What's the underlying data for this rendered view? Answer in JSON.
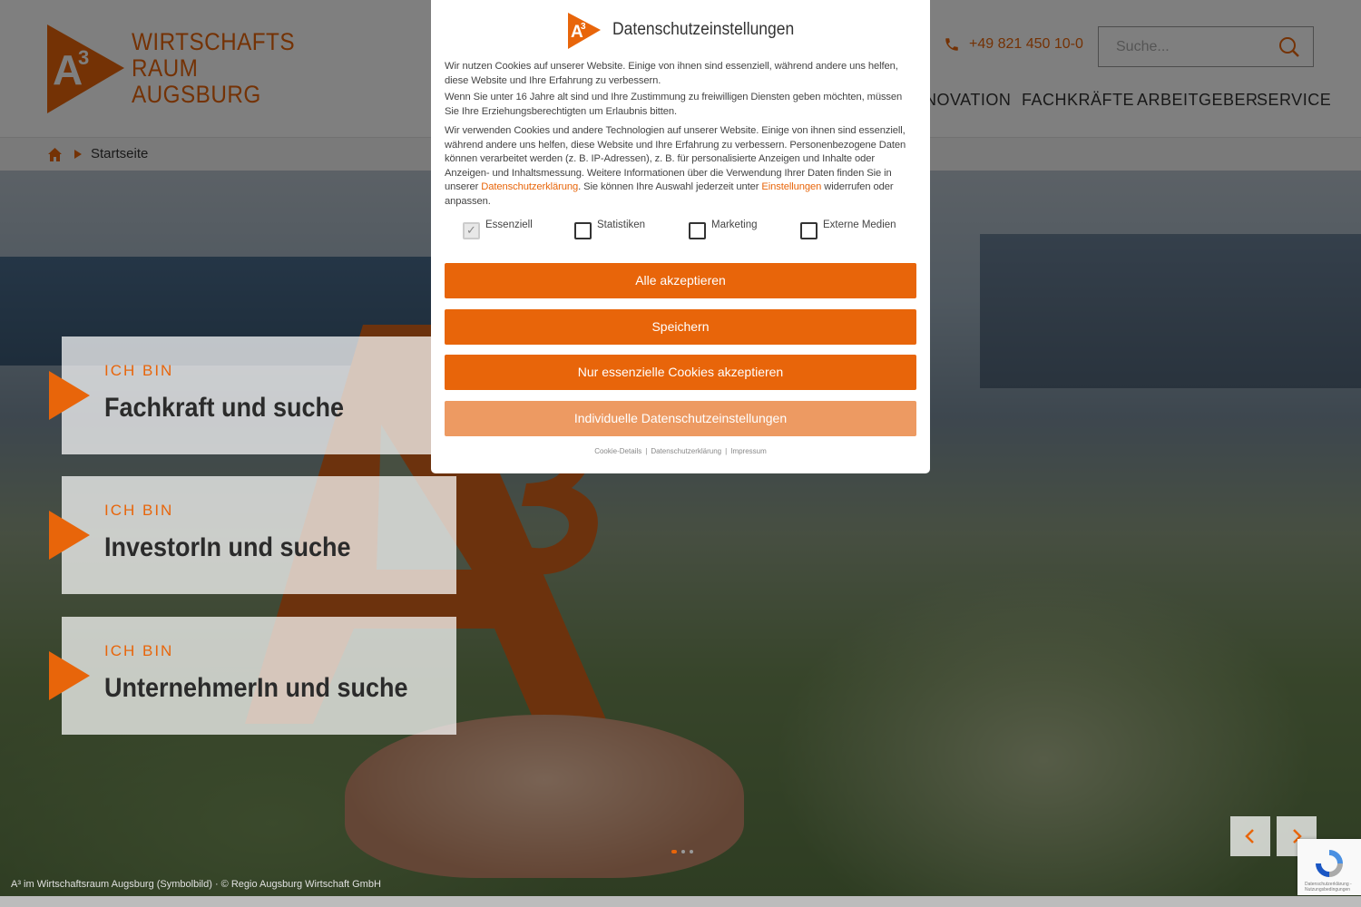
{
  "header": {
    "logo_lines": [
      "WIRTSCHAFTS",
      "RAUM",
      "AUGSBURG"
    ],
    "phone": "+49 821 450 10-0",
    "search_placeholder": "Suche...",
    "nav": [
      "INNOVATION",
      "FACHKRÄFTE",
      "ARBEITGEBER",
      "SERVICE"
    ]
  },
  "breadcrumb": {
    "current": "Startseite"
  },
  "hero": {
    "cards": [
      {
        "kicker": "ICH BIN",
        "title": "Fachkraft und suche"
      },
      {
        "kicker": "ICH BIN",
        "title": "InvestorIn und suche"
      },
      {
        "kicker": "ICH BIN",
        "title": "UnternehmerIn und suche"
      }
    ],
    "caption": "A³ im Wirtschaftsraum Augsburg (Symbolbild) · © Regio Augsburg Wirtschaft GmbH"
  },
  "recaptcha": {
    "text": "Datenschutzerklärung - Nutzungsbedingungen"
  },
  "consent": {
    "title": "Datenschutzeinstellungen",
    "p1": "Wir nutzen Cookies auf unserer Website. Einige von ihnen sind essenziell, während andere uns helfen, diese Website und Ihre Erfahrung zu verbessern.",
    "p2": "Wenn Sie unter 16 Jahre alt sind und Ihre Zustimmung zu freiwilligen Diensten geben möchten, müssen Sie Ihre Erziehungsberechtigten um Erlaubnis bitten.",
    "p3_before": "Wir verwenden Cookies und andere Technologien auf unserer Website. Einige von ihnen sind essenziell, während andere uns helfen, diese Website und Ihre Erfahrung zu verbessern. Personenbezogene Daten können verarbeitet werden (z. B. IP-Adressen), z. B. für personalisierte Anzeigen und Inhalte oder Anzeigen- und Inhaltsmessung. Weitere Informationen über die Verwendung Ihrer Daten finden Sie in unserer ",
    "p3_link1": "Datenschutzerklärung",
    "p3_middle": ". Sie können Ihre Auswahl jederzeit unter ",
    "p3_link2": "Einstellungen",
    "p3_after": " widerrufen oder anpassen.",
    "checkboxes": [
      {
        "label": "Essenziell",
        "checked": true
      },
      {
        "label": "Statistiken",
        "checked": false
      },
      {
        "label": "Marketing",
        "checked": false
      },
      {
        "label": "Externe Medien",
        "checked": false
      }
    ],
    "buttons": {
      "accept_all": "Alle akzeptieren",
      "save": "Speichern",
      "essential_only": "Nur essenzielle Cookies akzeptieren",
      "individual": "Individuelle Datenschutzeinstellungen"
    },
    "footer_links": [
      "Cookie-Details",
      "Datenschutzerklärung",
      "Impressum"
    ]
  },
  "colors": {
    "accent": "#e8650a",
    "accent_light": "#ed9a62"
  }
}
